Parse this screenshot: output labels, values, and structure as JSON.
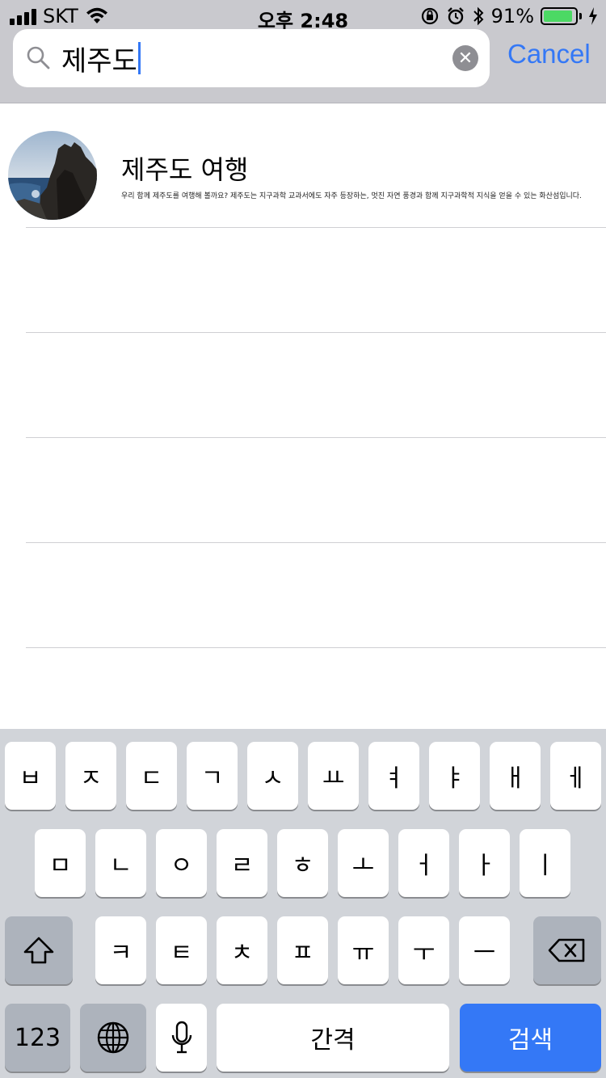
{
  "status_bar": {
    "carrier": "SKT",
    "time": "오후 2:48",
    "battery_percent": "91%",
    "battery_level": 0.91,
    "icons": [
      "signal-icon",
      "wifi-icon",
      "rotation-lock-icon",
      "alarm-icon",
      "bluetooth-icon",
      "battery-icon",
      "charging-icon"
    ]
  },
  "search": {
    "query": "제주도",
    "cancel_label": "Cancel"
  },
  "results": [
    {
      "title": "제주도 여행",
      "description": "우리 함께 제주도를 여행해 볼까요? 제주도는 지구과학 교과서에도 자주 등장하는, 멋진 자연 풍경과 함께 지구과학적 지식을 얻을 수 있는 화산섬입니다."
    }
  ],
  "keyboard": {
    "row1": [
      "ㅂ",
      "ㅈ",
      "ㄷ",
      "ㄱ",
      "ㅅ",
      "ㅛ",
      "ㅕ",
      "ㅑ",
      "ㅐ",
      "ㅔ"
    ],
    "row2": [
      "ㅁ",
      "ㄴ",
      "ㅇ",
      "ㄹ",
      "ㅎ",
      "ㅗ",
      "ㅓ",
      "ㅏ",
      "ㅣ"
    ],
    "row3": [
      "ㅋ",
      "ㅌ",
      "ㅊ",
      "ㅍ",
      "ㅠ",
      "ㅜ",
      "ㅡ"
    ],
    "numbers_label": "123",
    "space_label": "간격",
    "search_label": "검색"
  },
  "colors": {
    "accent": "#3478f6",
    "battery_fill": "#4cd964",
    "keyboard_bg": "#d1d4d9",
    "search_bg": "#c9c9ce"
  }
}
